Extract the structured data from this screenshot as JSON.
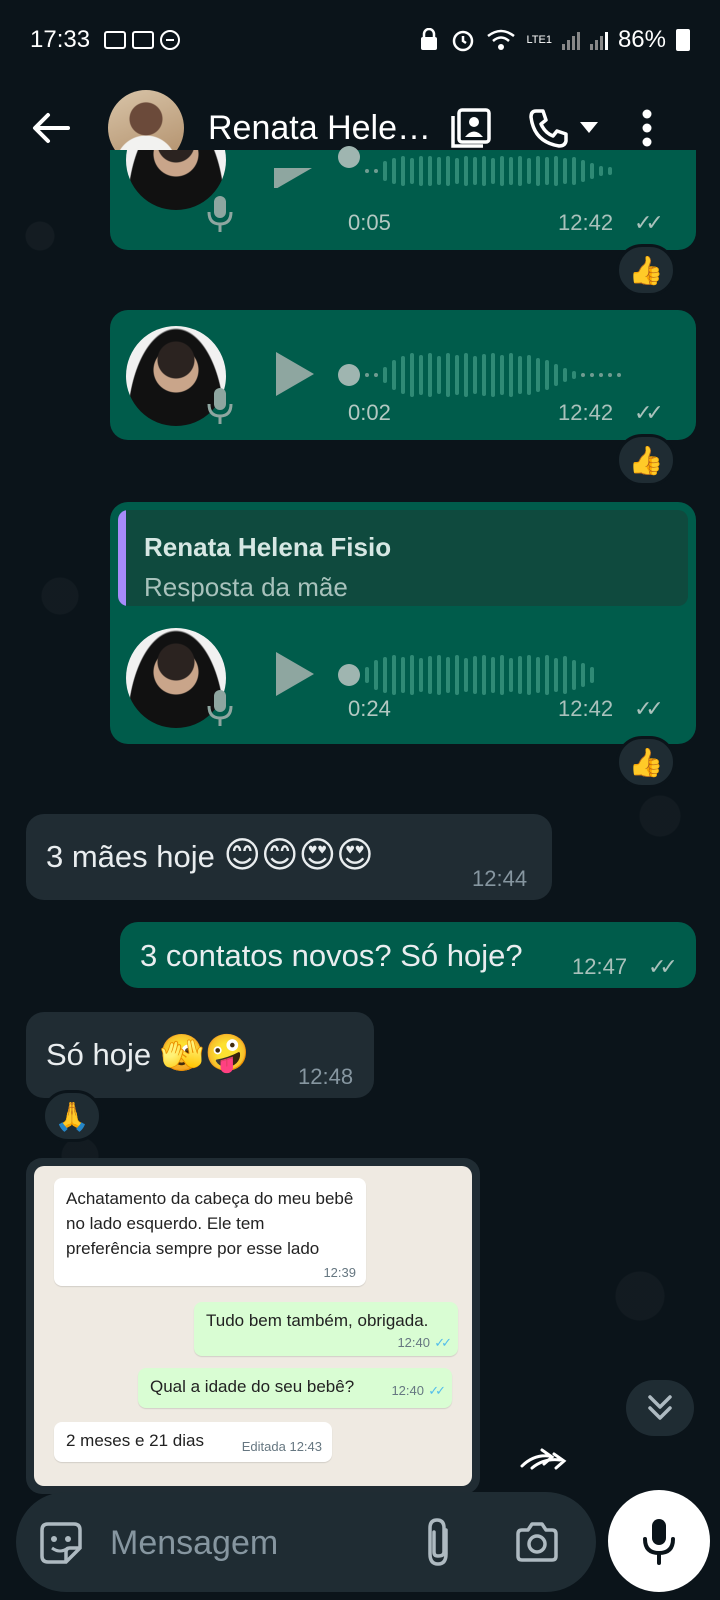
{
  "status_bar": {
    "time": "17:33",
    "battery": "86%",
    "network": "LTE1"
  },
  "header": {
    "contact_name": "Renata Hele…"
  },
  "voice_messages": [
    {
      "duration": "0:05",
      "time": "12:42",
      "reaction": "👍"
    },
    {
      "duration": "0:02",
      "time": "12:42",
      "reaction": "👍"
    },
    {
      "duration": "0:24",
      "time": "12:42",
      "reaction": "👍",
      "reply": {
        "name": "Renata Helena Fisio",
        "text": "Resposta da mãe"
      }
    }
  ],
  "messages": [
    {
      "text": "3 mães hoje",
      "emojis": "😊😊😍😍",
      "time": "12:44",
      "direction": "in"
    },
    {
      "text": "3 contatos novos? Só hoje?",
      "time": "12:47",
      "direction": "out"
    },
    {
      "text": "Só hoje",
      "emojis": "🫣🤪",
      "time": "12:48",
      "direction": "in",
      "reaction": "🙏"
    }
  ],
  "screenshot_image": {
    "messages": [
      {
        "text": "Achatamento da cabeça do meu bebê no lado esquerdo. Ele tem preferência sempre por esse lado",
        "time": "12:39",
        "direction": "in"
      },
      {
        "text": "Tudo bem também, obrigada.",
        "time": "12:40",
        "direction": "out"
      },
      {
        "text": "Qual a idade do seu bebê?",
        "time": "12:40",
        "direction": "out"
      },
      {
        "text": "2 meses e 21 dias",
        "time": "Editada 12:43",
        "direction": "in"
      }
    ]
  },
  "input": {
    "placeholder": "Mensagem"
  },
  "ticks": "✓✓",
  "colors": {
    "outgoing_bubble": "#005c4b",
    "incoming_bubble": "#202c33",
    "background": "#0b141a",
    "reply_accent": "#a78bfa"
  }
}
